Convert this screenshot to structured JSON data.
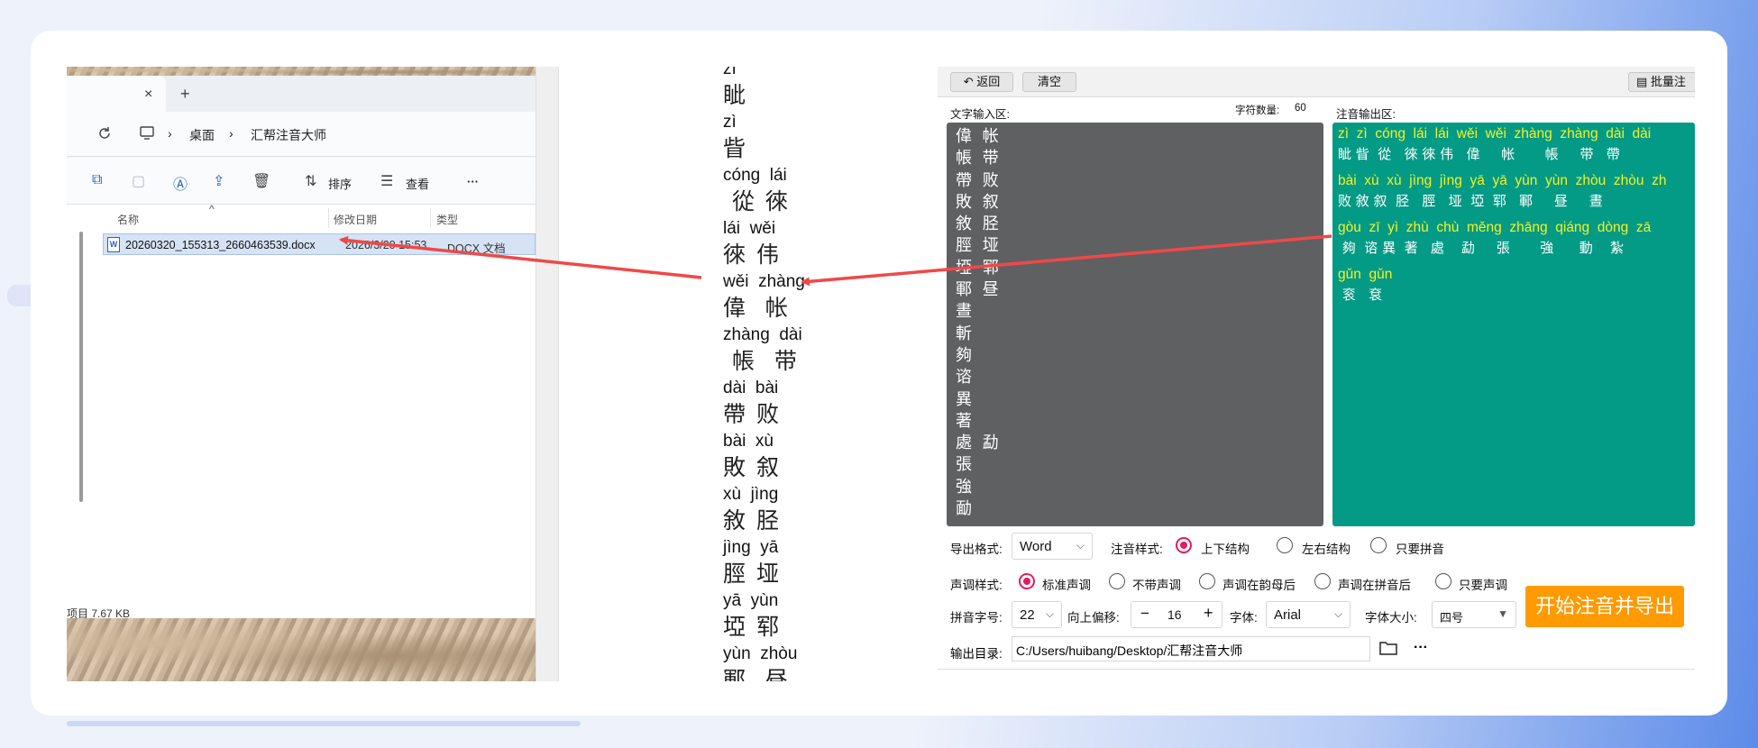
{
  "explorer": {
    "tab_close": "×",
    "tab_add": "+",
    "breadcrumb": [
      "桌面",
      "汇帮注音大师"
    ],
    "toolbar": {
      "sort_label": "排序",
      "view_label": "查看",
      "more": "···"
    },
    "columns": [
      "名称",
      "修改日期",
      "类型"
    ],
    "file": {
      "name": "20260320_155313_2660463539.docx",
      "date": "2026/3/20 15:53",
      "type": "DOCX 文档",
      "icon": "W"
    },
    "status": "项目  7.67 KB"
  },
  "document": {
    "lines": [
      {
        "py": "zì",
        "hz": "眦"
      },
      {
        "py": "zì",
        "hz": "眥"
      },
      {
        "py": "cóng  lái",
        "hz": " 從 徠"
      },
      {
        "py": "lái  wěi",
        "hz": "徠 伟"
      },
      {
        "py": "wěi  zhàng",
        "hz": "偉  帐"
      },
      {
        "py": "zhàng  dài",
        "hz": " 帳  带"
      },
      {
        "py": "dài  bài",
        "hz": "帶 败"
      },
      {
        "py": "bài  xù",
        "hz": "敗 叙"
      },
      {
        "py": "xù  jìng",
        "hz": "敘 胫"
      },
      {
        "py": "jìng  yā",
        "hz": "脛 垭"
      },
      {
        "py": "yā  yùn",
        "hz": "埡 郓"
      },
      {
        "py": "yùn  zhòu",
        "hz": "鄆  昼"
      }
    ]
  },
  "app": {
    "back_label": "返回",
    "clear_label": "清空",
    "batch_label": "批量注",
    "input_title": "文字输入区:",
    "char_count_label": "字符数量:",
    "char_count": "60",
    "output_title": "注音输出区:",
    "input_lines": [
      "偉 帐",
      "帳 带",
      "帶 败",
      "敗 叙",
      "敘 胫",
      "脛 垭",
      "埡 郓",
      "鄆 昼",
      "晝",
      "斬",
      "夠",
      "谘",
      "異",
      "著",
      "處 勐",
      "張",
      "強",
      "勔"
    ],
    "output_rows": [
      {
        "py": "zì  zì  cóng  lái  lái  wěi  wěi  zhàng  zhàng  dài  dài",
        "hz": "眦 眥  從   徠 徠 伟   偉     帐       帳     带   帶"
      },
      {
        "py": "bài  xù  xù  jìng  jìng  yā  yā  yùn  yùn  zhòu  zhòu  zh",
        "hz": "败 敘 叙  胫   脛   垭  埡  郓   鄆     昼     晝    "
      },
      {
        "py": "gòu  zī  yì  zhù  chù  měng  zhāng  qiáng  dòng  zā",
        "hz": " 夠  谘 異  著   處    勐     張       強      動    紮"
      },
      {
        "py": "gǔn  gǔn",
        "hz": " 衮   袞"
      }
    ],
    "export_format_label": "导出格式:",
    "export_format": "Word",
    "style_label": "注音样式:",
    "style_options": [
      "上下结构",
      "左右结构",
      "只要拼音"
    ],
    "tone_label": "声调样式:",
    "tone_options": [
      "标准声调",
      "不带声调",
      "声调在韵母后",
      "声调在拼音后",
      "只要声调"
    ],
    "pinyin_size_label": "拼音字号:",
    "pinyin_size": "22",
    "offset_label": "向上偏移:",
    "offset_minus": "−",
    "offset_value": "16",
    "offset_plus": "+",
    "font_label": "字体:",
    "font_value": "Arial",
    "font_size_label": "字体大小:",
    "font_size_value": "四号",
    "start_label": "开始注音并导出",
    "output_dir_label": "输出目录:",
    "output_dir": "C:/Users/huibang/Desktop/汇帮注音大师",
    "more": "···"
  },
  "colors": {
    "arrow": "#f04848",
    "accent": "#ff9a00",
    "output_bg": "#039a86",
    "input_bg": "#5f6062",
    "pinyin_yellow": "#f5f222",
    "radio_on": "#e31c5f"
  }
}
